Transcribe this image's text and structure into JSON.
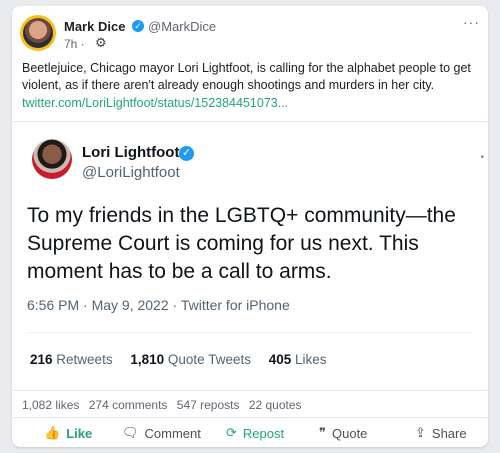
{
  "post": {
    "author_name": "Mark Dice",
    "handle": "@MarkDice",
    "time": "7h ·",
    "text": "Beetlejuice, Chicago mayor Lori Lightfoot, is calling for the alphabet people to get violent, as if there aren't already enough shootings and murders in her city.",
    "link": "twitter.com/LoriLightfoot/status/152384451073..."
  },
  "embed": {
    "name": "Lori Lightfoot",
    "handle": "@LoriLightfoot",
    "text": "To my friends in the LGBTQ+ community—the Supreme Court is coming for us next. This moment has to be a call to arms.",
    "meta": "6:56 PM · May 9, 2022 · Twitter for iPhone",
    "retweets_num": "216",
    "retweets_label": "Retweets",
    "quote_num": "1,810",
    "quote_label": "Quote Tweets",
    "likes_num": "405",
    "likes_label": "Likes"
  },
  "reactions": {
    "likes": "1,082 likes",
    "comments": "274 comments",
    "reposts": "547 reposts",
    "quotes": "22 quotes"
  },
  "actions": {
    "like": "Like",
    "comment": "Comment",
    "repost": "Repost",
    "quote": "Quote",
    "share": "Share"
  },
  "icons": {
    "like": "thumbs-up-icon",
    "comment": "comment-icon",
    "repost": "repost-icon",
    "quote": "quote-icon",
    "share": "share-icon",
    "visibility": "globe-icon",
    "more": "more-icon"
  },
  "colors": {
    "accent": "#21a67a",
    "verified": "#1d9bf0"
  }
}
